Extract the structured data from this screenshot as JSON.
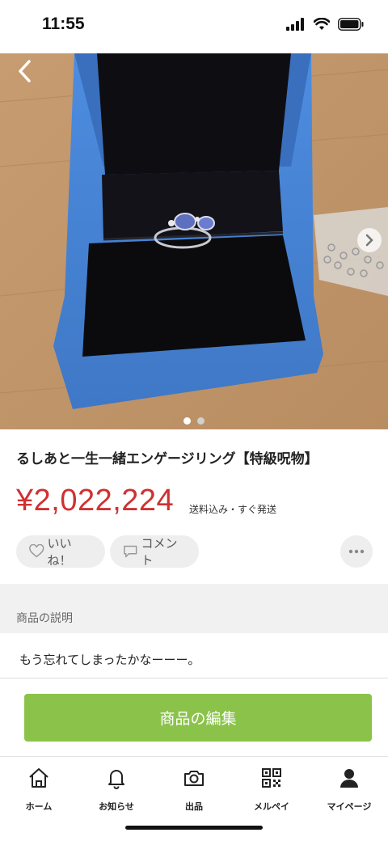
{
  "status_bar": {
    "time": "11:55"
  },
  "product": {
    "title": "るしあと一生一緒エンゲージリング【特級呪物】",
    "price": "¥2,022,224",
    "price_note": "送料込み・すぐ発送",
    "image_count": 2,
    "active_image": 1
  },
  "actions": {
    "like_label": "いいね！",
    "comment_label": "コメント"
  },
  "description": {
    "header": "商品の説明",
    "text": "もう忘れてしまったかなーーー。"
  },
  "edit_button": {
    "label": "商品の編集"
  },
  "tabs": [
    {
      "label": "ホーム",
      "icon": "home-icon"
    },
    {
      "label": "お知らせ",
      "icon": "bell-icon"
    },
    {
      "label": "出品",
      "icon": "camera-icon"
    },
    {
      "label": "メルペイ",
      "icon": "qr-code-icon"
    },
    {
      "label": "マイページ",
      "icon": "person-icon"
    }
  ],
  "colors": {
    "price": "#cf3131",
    "edit_button": "#8bc34a",
    "box": "#4a86d6"
  }
}
